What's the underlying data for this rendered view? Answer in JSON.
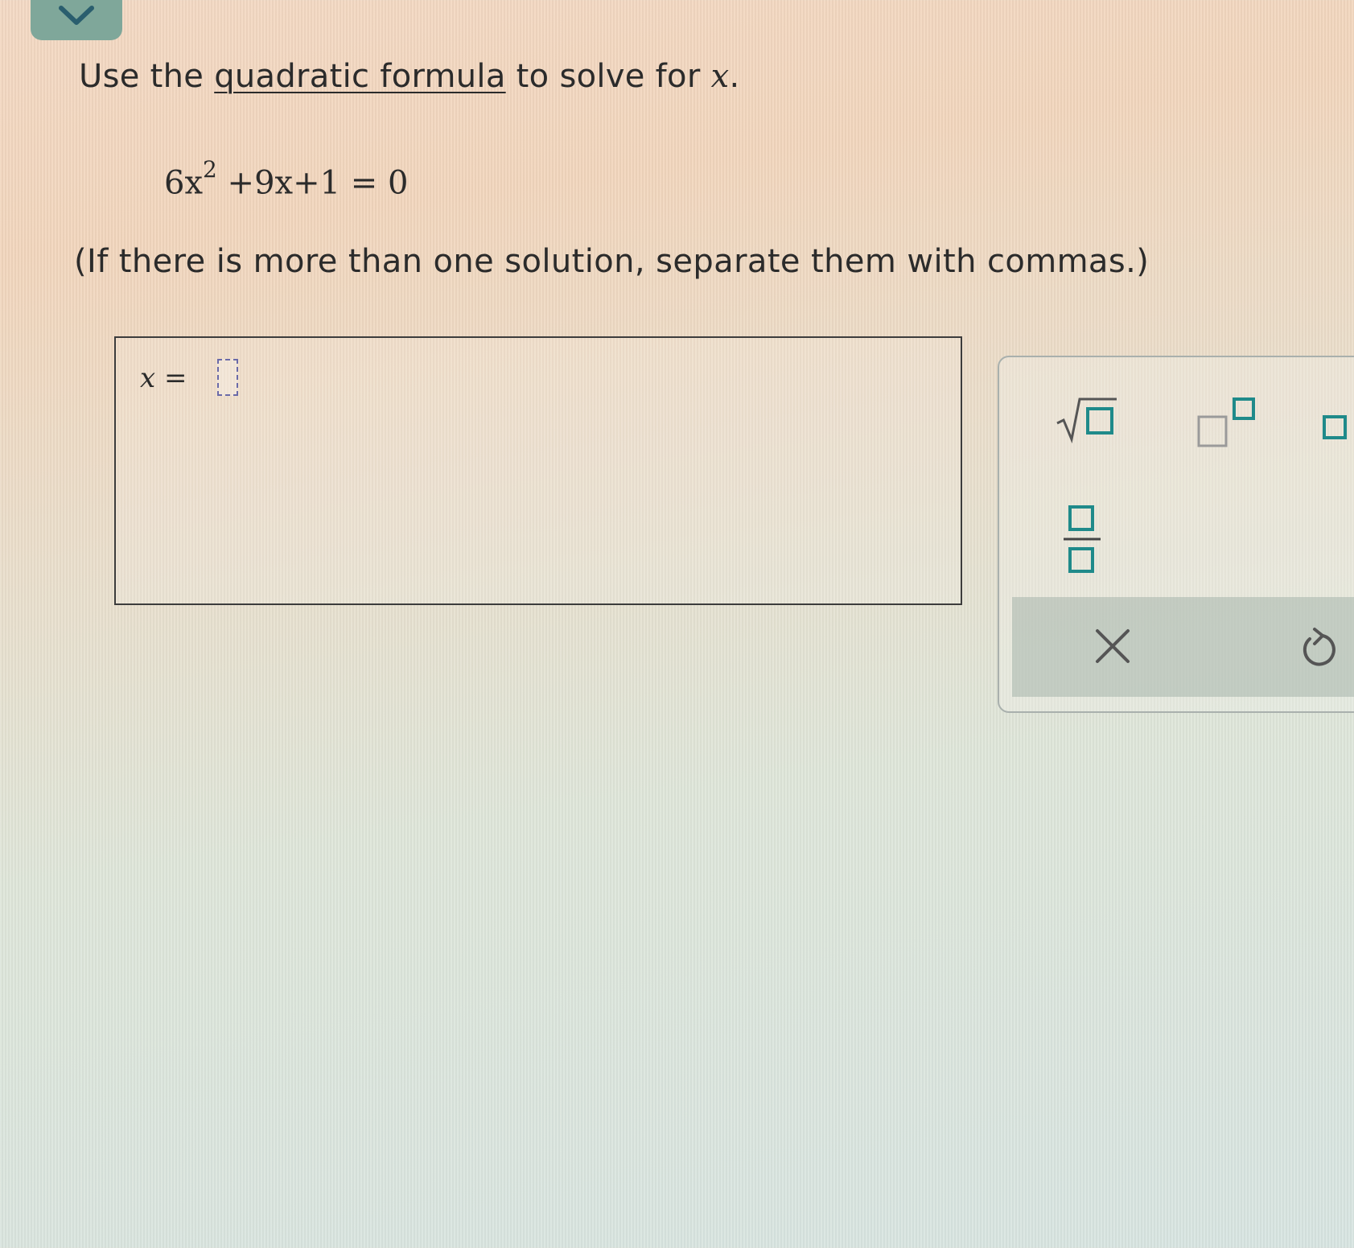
{
  "question": {
    "prefix": "Use the ",
    "link_text": "quadratic formula",
    "suffix": " to solve for ",
    "variable": "x",
    "end": "."
  },
  "equation": {
    "coef_a": "6x",
    "exponent": "2",
    "rest": " +9x+1 = 0"
  },
  "instruction": "(If there is more than one solution, separate them with commas.)",
  "answer": {
    "variable": "x",
    "equals": " = ",
    "value": ""
  },
  "toolbar": {
    "tools": [
      "sqrt-icon",
      "exponent-icon",
      "subscript-icon",
      "fraction-icon",
      "clear-icon",
      "undo-icon"
    ]
  },
  "colors": {
    "tab": "#7fa79a",
    "tool_box": "#1f8a8a",
    "tool_grey": "#9a9a9a"
  }
}
